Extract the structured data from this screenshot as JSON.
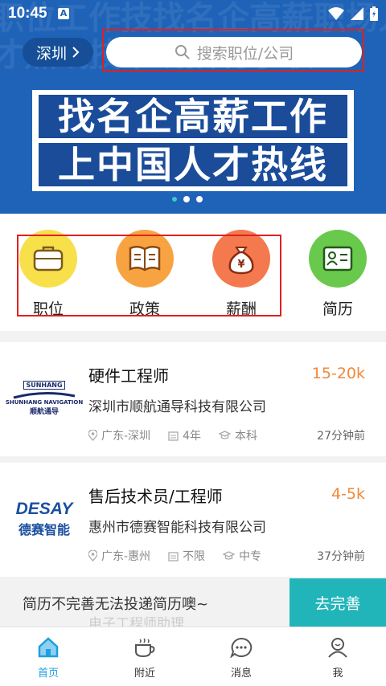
{
  "status": {
    "time": "10:45",
    "notif_icon": "A"
  },
  "header": {
    "city": "深圳",
    "search_placeholder": "搜索职位/公司",
    "banner_line1": "找名企高薪工作",
    "banner_line2": "上中国人才热线",
    "watermark": "职位工作技找名企高薪职场人才热线技术线招聘求职"
  },
  "categories": [
    {
      "label": "职位",
      "icon": "briefcase-icon",
      "color": "#f7e04a"
    },
    {
      "label": "政策",
      "icon": "book-icon",
      "color": "#f8a341"
    },
    {
      "label": "薪酬",
      "icon": "money-bag-icon",
      "color": "#f4794e"
    },
    {
      "label": "简历",
      "icon": "resume-icon",
      "color": "#69c94c"
    }
  ],
  "jobs": [
    {
      "title": "硬件工程师",
      "salary": "15-20k",
      "company": "深圳市顺航通导科技有限公司",
      "location": "广东-深圳",
      "experience": "4年",
      "education": "本科",
      "posted": "27分钟前",
      "logo_en": "SHUNHANG NAVIGATION",
      "logo_cn": "顺航通导",
      "logo_top": "SUNHANG"
    },
    {
      "title": "售后技术员/工程师",
      "salary": "4-5k",
      "company": "惠州市德赛智能科技有限公司",
      "location": "广东-惠州",
      "experience": "不限",
      "education": "中专",
      "posted": "37分钟前",
      "logo_en": "DESAY",
      "logo_cn": "德赛智能"
    }
  ],
  "prompt": {
    "text": "简历不完善无法投递简历噢~",
    "button": "去完善",
    "behind_text": "电子工程师助理"
  },
  "nav": [
    {
      "label": "首页",
      "icon": "home-icon",
      "active": true
    },
    {
      "label": "附近",
      "icon": "coffee-icon",
      "active": false
    },
    {
      "label": "消息",
      "icon": "chat-icon",
      "active": false
    },
    {
      "label": "我",
      "icon": "user-icon",
      "active": false
    }
  ],
  "colors": {
    "primary": "#1f63b8",
    "accent": "#21b5ba",
    "salary": "#f0883a",
    "nav_active": "#1e9fe0"
  }
}
